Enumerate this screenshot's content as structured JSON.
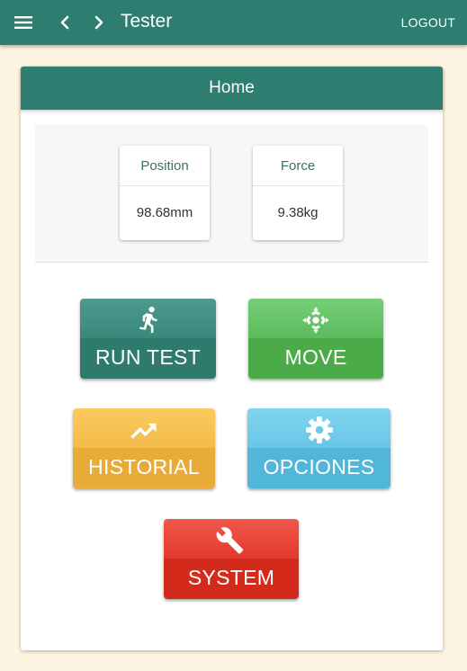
{
  "app": {
    "title": "Tester",
    "logout_label": "LOGOUT",
    "icons": {
      "menu": "hamburger-menu-icon",
      "back": "chevron-left-icon",
      "forward": "chevron-right-icon"
    }
  },
  "home": {
    "header": "Home",
    "readouts": [
      {
        "label": "Position",
        "value": "98.68mm"
      },
      {
        "label": "Force",
        "value": "9.38kg"
      }
    ],
    "tiles": [
      {
        "label": "RUN TEST",
        "icon": "running-person-icon",
        "color": "#2e7b6e"
      },
      {
        "label": "MOVE",
        "icon": "move-arrows-icon",
        "color": "#4aab48"
      },
      {
        "label": "HISTORIAL",
        "icon": "trending-up-icon",
        "color": "#e8ab38"
      },
      {
        "label": "OPCIONES",
        "icon": "gear-icon",
        "color": "#50b6da"
      },
      {
        "label": "SYSTEM",
        "icon": "wrench-icon",
        "color": "#d42a1c"
      }
    ]
  },
  "colors": {
    "primary": "#2e7d71",
    "background": "#fdf5e1",
    "label_text": "#3d6f68"
  }
}
